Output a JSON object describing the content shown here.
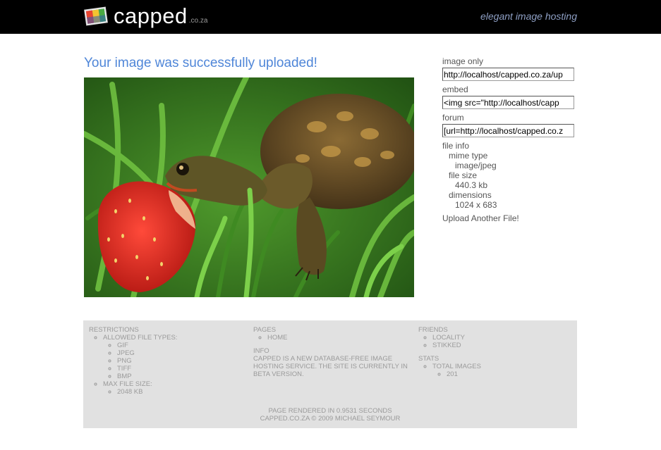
{
  "header": {
    "logo_text": "capped",
    "logo_domain": ".co.za",
    "tagline": "elegant image hosting"
  },
  "main": {
    "title": "Your image was successfully uploaded!"
  },
  "sidebar": {
    "image_only_label": "image only",
    "image_only_value": "http://localhost/capped.co.za/up",
    "embed_label": "embed",
    "embed_value": "<img src=\"http://localhost/capp",
    "forum_label": "forum",
    "forum_value": "[url=http://localhost/capped.co.z",
    "file_info": {
      "title": "file info",
      "mime_label": "mime type",
      "mime_value": "image/jpeg",
      "size_label": "file size",
      "size_value": "440.3 kb",
      "dimensions_label": "dimensions",
      "dimensions_value": "1024 x 683"
    },
    "upload_another": "Upload Another File!"
  },
  "footer": {
    "restrictions": {
      "title": "RESTRICTIONS",
      "allowed_label": "ALLOWED FILE TYPES:",
      "types": [
        "GIF",
        "JPEG",
        "PNG",
        "TIFF",
        "BMP"
      ],
      "max_label": "MAX FILE SIZE:",
      "max_value": "2048 KB"
    },
    "pages": {
      "title": "PAGES",
      "items": [
        "HOME"
      ]
    },
    "info": {
      "title": "INFO",
      "text": "CAPPED IS A NEW DATABASE-FREE IMAGE HOSTING SERVICE. THE SITE IS CURRENTLY IN BETA VERSION."
    },
    "friends": {
      "title": "FRIENDS",
      "items": [
        "LOCALITY",
        "STIKKED"
      ]
    },
    "stats": {
      "title": "STATS",
      "total_label": "TOTAL IMAGES",
      "total_value": "201"
    },
    "rendered": "PAGE RENDERED IN 0.9531 SECONDS",
    "copyright": "CAPPED.CO.ZA © 2009 MICHAEL SEYMOUR"
  }
}
